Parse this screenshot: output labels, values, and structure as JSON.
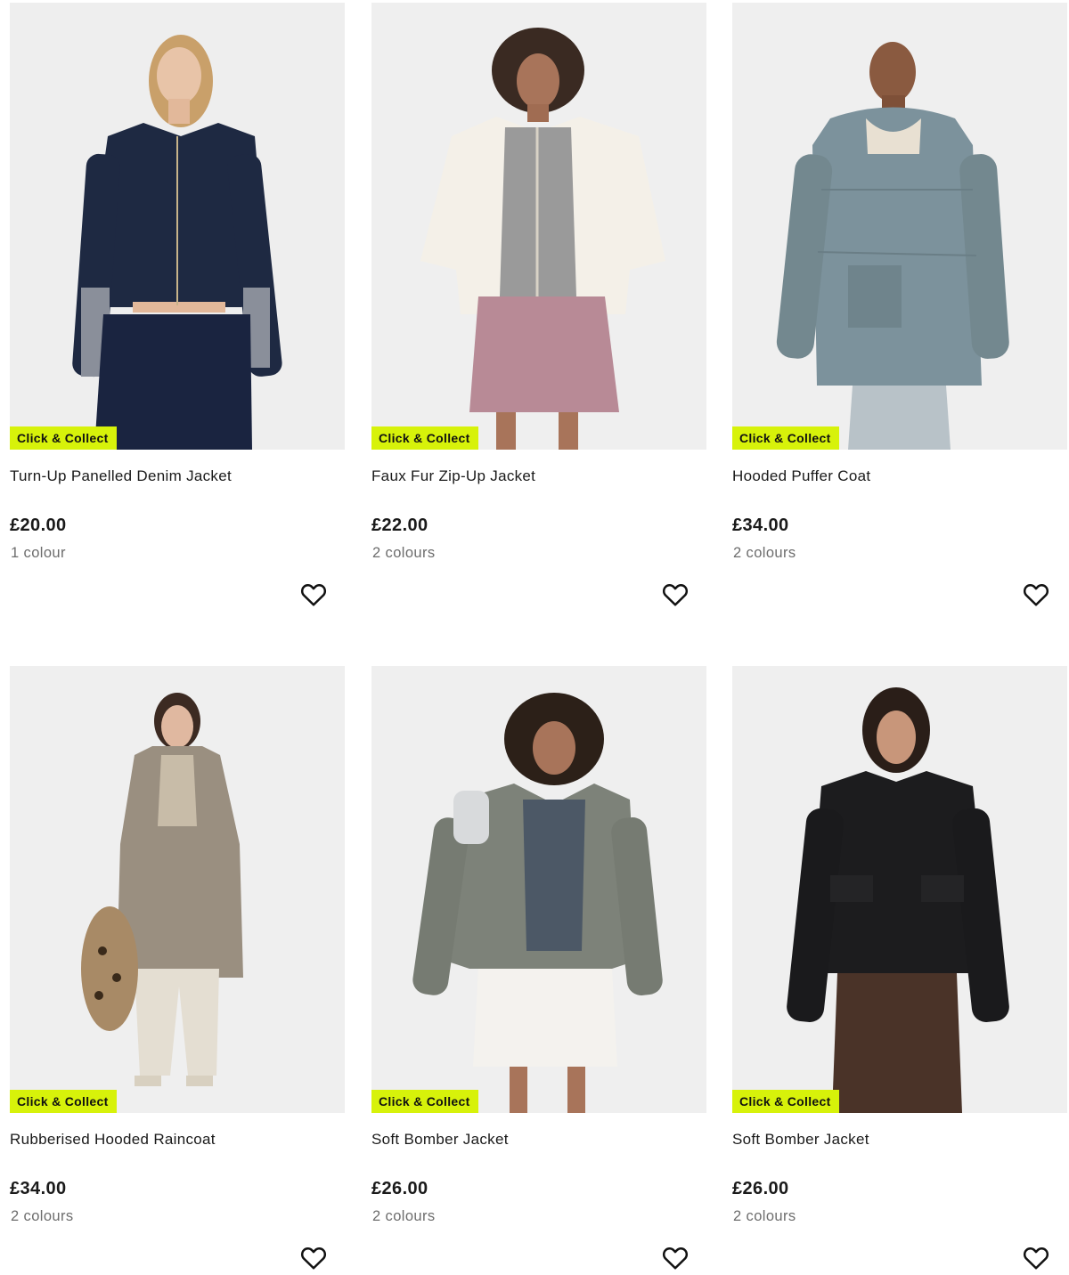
{
  "badge_label": "Click & Collect",
  "products": [
    {
      "title": "Turn-Up Panelled Denim Jacket",
      "price": "£20.00",
      "colours": "1 colour",
      "badge": "Click & Collect",
      "garment_color": "#1e2942",
      "image_icon": "model-photo-denim-jacket"
    },
    {
      "title": "Faux Fur Zip-Up Jacket",
      "price": "£22.00",
      "colours": "2 colours",
      "badge": "Click & Collect",
      "garment_color": "#f4f0e8",
      "image_icon": "model-photo-faux-fur-jacket"
    },
    {
      "title": "Hooded Puffer Coat",
      "price": "£34.00",
      "colours": "2 colours",
      "badge": "Click & Collect",
      "garment_color": "#7c929c",
      "image_icon": "model-photo-puffer-coat"
    },
    {
      "title": "Rubberised Hooded Raincoat",
      "price": "£34.00",
      "colours": "2 colours",
      "badge": "Click & Collect",
      "garment_color": "#9a8f80",
      "image_icon": "model-photo-raincoat"
    },
    {
      "title": "Soft Bomber Jacket",
      "price": "£26.00",
      "colours": "2 colours",
      "badge": "Click & Collect",
      "garment_color": "#7d8279",
      "image_icon": "model-photo-bomber-khaki"
    },
    {
      "title": "Soft Bomber Jacket",
      "price": "£26.00",
      "colours": "2 colours",
      "badge": "Click & Collect",
      "garment_color": "#1c1c1e",
      "image_icon": "model-photo-bomber-black"
    }
  ],
  "colors": {
    "badge_bg": "#d7f20a",
    "image_bg": "#efefef",
    "secondary_text": "#6d6d6d"
  }
}
